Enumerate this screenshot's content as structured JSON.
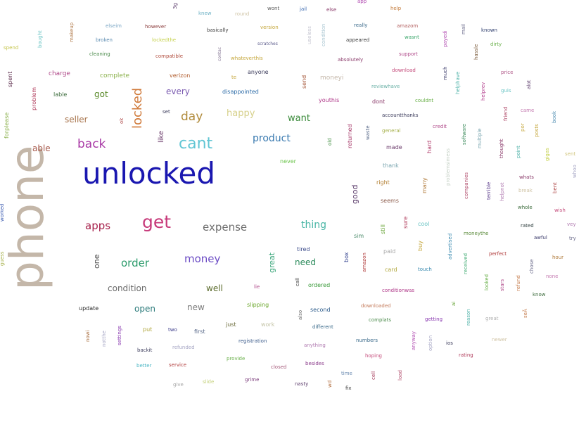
{
  "words": [
    {
      "text": "phone",
      "color": "#c4b7a9"
    },
    {
      "text": "unlocked",
      "color": "#1a17b0"
    },
    {
      "text": "get",
      "color": "#c73a7a"
    },
    {
      "text": "cant",
      "color": "#62c6d4"
    },
    {
      "text": "back",
      "color": "#a93aa6"
    },
    {
      "text": "locked",
      "color": "#d07a3a"
    },
    {
      "text": "day",
      "color": "#b08a3a"
    },
    {
      "text": "apps",
      "color": "#a61f4a"
    },
    {
      "text": "expense",
      "color": "#6f6f6f"
    },
    {
      "text": "money",
      "color": "#6a4ac4"
    },
    {
      "text": "order",
      "color": "#2a9a6a"
    },
    {
      "text": "product",
      "color": "#3a7ab0"
    },
    {
      "text": "thing",
      "color": "#4ab6a6"
    },
    {
      "text": "want",
      "color": "#3a8a3a"
    },
    {
      "text": "happy",
      "color": "#d6d08a"
    },
    {
      "text": "seller",
      "color": "#a6724a"
    },
    {
      "text": "every",
      "color": "#7a5ab0"
    },
    {
      "text": "got",
      "color": "#5a8a2a"
    },
    {
      "text": "able",
      "color": "#a6584a"
    },
    {
      "text": "condition",
      "color": "#6a6a6a"
    },
    {
      "text": "open",
      "color": "#2a7a7a"
    },
    {
      "text": "new",
      "color": "#7a7a7a"
    },
    {
      "text": "well",
      "color": "#5a6a2a"
    },
    {
      "text": "need",
      "color": "#2a8a5a"
    },
    {
      "text": "great",
      "color": "#3aa67a"
    },
    {
      "text": "good",
      "color": "#5a3a6a"
    },
    {
      "text": "one",
      "color": "#4a4a4a"
    },
    {
      "text": "like",
      "color": "#6a3a6a"
    },
    {
      "text": "charge",
      "color": "#b04a8a"
    },
    {
      "text": "complete",
      "color": "#8ab04a"
    },
    {
      "text": "verizon",
      "color": "#b05a2a"
    },
    {
      "text": "anyone",
      "color": "#3a3a5a"
    },
    {
      "text": "disappointed",
      "color": "#2a6aa6"
    },
    {
      "text": "problem",
      "color": "#b03a5a"
    },
    {
      "text": "lable",
      "color": "#3a6a3a"
    },
    {
      "text": "spent",
      "color": "#5a2a4a"
    },
    {
      "text": "forplease",
      "color": "#8ab04a"
    },
    {
      "text": "worked",
      "color": "#3a5ab0"
    },
    {
      "text": "guess",
      "color": "#a6b04a"
    },
    {
      "text": "never",
      "color": "#6ac44a"
    },
    {
      "text": "sim",
      "color": "#4a8a6a"
    },
    {
      "text": "tired",
      "color": "#3a4a8a"
    },
    {
      "text": "ordered",
      "color": "#3a9a3a"
    },
    {
      "text": "second",
      "color": "#2a5a8a"
    },
    {
      "text": "first",
      "color": "#5a6a8a"
    },
    {
      "text": "update",
      "color": "#2a2a2a"
    },
    {
      "text": "slipping",
      "color": "#6aa62a"
    },
    {
      "text": "just",
      "color": "#6a6a3a"
    },
    {
      "text": "work",
      "color": "#c4c4a6"
    },
    {
      "text": "put",
      "color": "#b0a63a"
    },
    {
      "text": "two",
      "color": "#3a3a8a"
    },
    {
      "text": "backit",
      "color": "#3a3a5a"
    },
    {
      "text": "refunded",
      "color": "#a6a6c4"
    },
    {
      "text": "registration",
      "color": "#3a5a8a"
    },
    {
      "text": "provide",
      "color": "#6ab04a"
    },
    {
      "text": "closed",
      "color": "#a65a7a"
    },
    {
      "text": "besides",
      "color": "#8a3a8a"
    },
    {
      "text": "anything",
      "color": "#b07ab0"
    },
    {
      "text": "numbers",
      "color": "#3a6a8a"
    },
    {
      "text": "hoping",
      "color": "#c44a7a"
    },
    {
      "text": "time",
      "color": "#6a8ab0"
    },
    {
      "text": "nasty",
      "color": "#5a3a6a"
    },
    {
      "text": "grime",
      "color": "#7a3a7a"
    },
    {
      "text": "slide",
      "color": "#c4d07a"
    },
    {
      "text": "give",
      "color": "#a6a6a6"
    },
    {
      "text": "service",
      "color": "#b03a3a"
    },
    {
      "text": "better",
      "color": "#4ab6c4"
    },
    {
      "text": "nowi",
      "color": "#a66a3a"
    },
    {
      "text": "notthe",
      "color": "#a6a6c4"
    },
    {
      "text": "settings",
      "color": "#8a3ab0"
    },
    {
      "text": "different",
      "color": "#3a6a8a"
    },
    {
      "text": "also",
      "color": "#6a6a6a"
    },
    {
      "text": "call",
      "color": "#3a3a3a"
    },
    {
      "text": "lie",
      "color": "#b04a8a"
    },
    {
      "text": "downloaded",
      "color": "#c47a5a"
    },
    {
      "text": "complats",
      "color": "#4a8a4a"
    },
    {
      "text": "getting",
      "color": "#8a3ab0"
    },
    {
      "text": "ios",
      "color": "#3a3a5a"
    },
    {
      "text": "rating",
      "color": "#b03a5a"
    },
    {
      "text": "option",
      "color": "#a6a6c4"
    },
    {
      "text": "anyway",
      "color": "#b04ab0"
    },
    {
      "text": "load",
      "color": "#b04a6a"
    },
    {
      "text": "cell",
      "color": "#a63a5a"
    },
    {
      "text": "fix",
      "color": "#3a3a3a"
    },
    {
      "text": "wd",
      "color": "#b06a3a"
    },
    {
      "text": "conditionwas",
      "color": "#b03a8a"
    },
    {
      "text": "card",
      "color": "#b0a63a"
    },
    {
      "text": "paid",
      "color": "#a6a6a6"
    },
    {
      "text": "buy",
      "color": "#c4a63a"
    },
    {
      "text": "touch",
      "color": "#3a8ab0"
    },
    {
      "text": "cool",
      "color": "#6ac4c4"
    },
    {
      "text": "sure",
      "color": "#b03a5a"
    },
    {
      "text": "still",
      "color": "#6aa63a"
    },
    {
      "text": "amazon",
      "color": "#b03a3a"
    },
    {
      "text": "box",
      "color": "#2a3a8a"
    },
    {
      "text": "seems",
      "color": "#8a5a4a"
    },
    {
      "text": "right",
      "color": "#b07a2a"
    },
    {
      "text": "many",
      "color": "#b07a3a"
    },
    {
      "text": "thank",
      "color": "#7aa6b0"
    },
    {
      "text": "made",
      "color": "#6a3a6a"
    },
    {
      "text": "hard",
      "color": "#b03a6a"
    },
    {
      "text": "general",
      "color": "#a6b04a"
    },
    {
      "text": "credit",
      "color": "#b04a8a"
    },
    {
      "text": "accountthanks",
      "color": "#3a3a5a"
    },
    {
      "text": "dont",
      "color": "#8a3a6a"
    },
    {
      "text": "couldnt",
      "color": "#6ab04a"
    },
    {
      "text": "waste",
      "color": "#5a6a8a"
    },
    {
      "text": "returned",
      "color": "#a63a6a"
    },
    {
      "text": "old",
      "color": "#3a8a3a"
    },
    {
      "text": "youthis",
      "color": "#b03a8a"
    },
    {
      "text": "reviewhave",
      "color": "#6ab0a6"
    },
    {
      "text": "download",
      "color": "#c44a7a"
    },
    {
      "text": "moneyi",
      "color": "#c4b7a9"
    },
    {
      "text": "send",
      "color": "#a6583a"
    },
    {
      "text": "te",
      "color": "#c4a63a"
    },
    {
      "text": "support",
      "color": "#b04a8a"
    },
    {
      "text": "absolutely",
      "color": "#8a3a6a"
    },
    {
      "text": "appeared",
      "color": "#3a3a3a"
    },
    {
      "text": "wasnt",
      "color": "#3aa66a"
    },
    {
      "text": "amazom",
      "color": "#b05a5a"
    },
    {
      "text": "really",
      "color": "#3a6a8a"
    },
    {
      "text": "else",
      "color": "#8a3a6a"
    },
    {
      "text": "jail",
      "color": "#3a6ab0"
    },
    {
      "text": "wont",
      "color": "#5a5a5a"
    },
    {
      "text": "app",
      "color": "#b04ab0"
    },
    {
      "text": "help",
      "color": "#c47a3a"
    },
    {
      "text": "knew",
      "color": "#6ab0c4"
    },
    {
      "text": "round",
      "color": "#d0c4a6"
    },
    {
      "text": "version",
      "color": "#c4a63a"
    },
    {
      "text": "scratches",
      "color": "#5a5a8a"
    },
    {
      "text": "contac",
      "color": "#7a6a8a"
    },
    {
      "text": "whateverthis",
      "color": "#c4a63a"
    },
    {
      "text": "basically",
      "color": "#3a3a3a"
    },
    {
      "text": "however",
      "color": "#8a3a3a"
    },
    {
      "text": "lockedthe",
      "color": "#c4d04a"
    },
    {
      "text": "compatible",
      "color": "#b04a3a"
    },
    {
      "text": "broken",
      "color": "#5a8ab0"
    },
    {
      "text": "cleaning",
      "color": "#4a8a4a"
    },
    {
      "text": "elseim",
      "color": "#7aa6c4"
    },
    {
      "text": "makeup",
      "color": "#b07a4a"
    },
    {
      "text": "bought",
      "color": "#6ac4c4"
    },
    {
      "text": "spend",
      "color": "#c4c44a"
    },
    {
      "text": "3g",
      "color": "#5a3a6a"
    },
    {
      "text": "ok",
      "color": "#b04a4a"
    },
    {
      "text": "set",
      "color": "#3a3a5a"
    },
    {
      "text": "useless",
      "color": "#c4c4d0"
    },
    {
      "text": "condition",
      "color": "#a6c4d0"
    },
    {
      "text": "payedi",
      "color": "#b04ab0"
    },
    {
      "text": "mail",
      "color": "#6a6a8a"
    },
    {
      "text": "hassle",
      "color": "#7a5a3a"
    },
    {
      "text": "known",
      "color": "#2a3a6a"
    },
    {
      "text": "dirty",
      "color": "#6ab04a"
    },
    {
      "text": "much",
      "color": "#3a3a6a"
    },
    {
      "text": "helphave",
      "color": "#4ab0a6"
    },
    {
      "text": "helprev",
      "color": "#b03a8a"
    },
    {
      "text": "price",
      "color": "#b05a8a"
    },
    {
      "text": "guis",
      "color": "#6ac4c4"
    },
    {
      "text": "alot",
      "color": "#5a3a6a"
    },
    {
      "text": "friend",
      "color": "#b04a6a"
    },
    {
      "text": "came",
      "color": "#c47ab0"
    },
    {
      "text": "book",
      "color": "#4a8ab0"
    },
    {
      "text": "software",
      "color": "#3a8a5a"
    },
    {
      "text": "multiple",
      "color": "#7aa6b0"
    },
    {
      "text": "thought",
      "color": "#8a3a6a"
    },
    {
      "text": "por",
      "color": "#c4a63a"
    },
    {
      "text": "posts",
      "color": "#c4a63a"
    },
    {
      "text": "point",
      "color": "#4ab0a6"
    },
    {
      "text": "gigas",
      "color": "#c4d04a"
    },
    {
      "text": "sent",
      "color": "#d0c47a"
    },
    {
      "text": "whoo",
      "color": "#a6a6c4"
    },
    {
      "text": "problemsimess",
      "color": "#c4d0c4"
    },
    {
      "text": "companies",
      "color": "#b04a6a"
    },
    {
      "text": "terrible",
      "color": "#5a3a8a"
    },
    {
      "text": "helpnot",
      "color": "#b07ab0"
    },
    {
      "text": "whats",
      "color": "#8a3a6a"
    },
    {
      "text": "break",
      "color": "#d0c4a6"
    },
    {
      "text": "bent",
      "color": "#b04a4a"
    },
    {
      "text": "whole",
      "color": "#3a6a3a"
    },
    {
      "text": "wish",
      "color": "#c44a7a"
    },
    {
      "text": "rated",
      "color": "#2a3a3a"
    },
    {
      "text": "vey",
      "color": "#b07ab0"
    },
    {
      "text": "moneythe",
      "color": "#5a8a3a"
    },
    {
      "text": "awful",
      "color": "#3a3a6a"
    },
    {
      "text": "try",
      "color": "#6a6a8a"
    },
    {
      "text": "advertised",
      "color": "#3a8ab0"
    },
    {
      "text": "perfect",
      "color": "#b03a3a"
    },
    {
      "text": "hour",
      "color": "#b07a3a"
    },
    {
      "text": "received",
      "color": "#4ab07a"
    },
    {
      "text": "chose",
      "color": "#6a6a8a"
    },
    {
      "text": "looked",
      "color": "#6ab04a"
    },
    {
      "text": "stars",
      "color": "#b04a8a"
    },
    {
      "text": "refund",
      "color": "#c47a4a"
    },
    {
      "text": "none",
      "color": "#c47ab0"
    },
    {
      "text": "know",
      "color": "#3a6a3a"
    },
    {
      "text": "ai",
      "color": "#6aa63a"
    },
    {
      "text": "reason",
      "color": "#4ab0a6"
    },
    {
      "text": "great",
      "color": "#b0b0b0"
    },
    {
      "text": "seÃ",
      "color": "#c47a4a"
    },
    {
      "text": "newer",
      "color": "#d0c4a6"
    }
  ]
}
